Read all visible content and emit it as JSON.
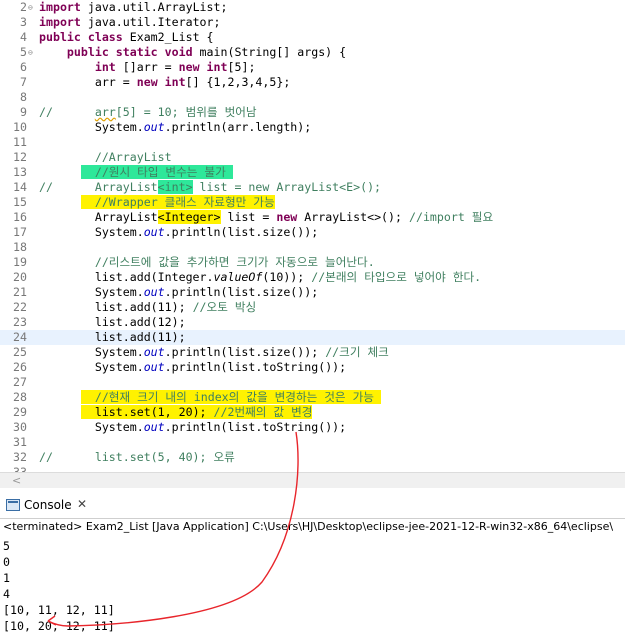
{
  "editor": {
    "lines": [
      {
        "n": "2",
        "fold": "⊖",
        "segs": [
          {
            "t": "import",
            "c": "kw"
          },
          {
            "t": " java.util.ArrayList;"
          }
        ]
      },
      {
        "n": "3",
        "segs": [
          {
            "t": "import",
            "c": "kw"
          },
          {
            "t": " java.util.Iterator;"
          }
        ]
      },
      {
        "n": "4",
        "segs": [
          {
            "t": "public class",
            "c": "kw"
          },
          {
            "t": " Exam2_List {"
          }
        ]
      },
      {
        "n": "5",
        "fold": "⊖",
        "segs": [
          {
            "t": "    "
          },
          {
            "t": "public static void",
            "c": "kw"
          },
          {
            "t": " main(String[] args) {"
          }
        ]
      },
      {
        "n": "6",
        "segs": [
          {
            "t": "        "
          },
          {
            "t": "int",
            "c": "kw"
          },
          {
            "t": " []arr = "
          },
          {
            "t": "new int",
            "c": "kw"
          },
          {
            "t": "[5];"
          }
        ]
      },
      {
        "n": "7",
        "segs": [
          {
            "t": "        arr = "
          },
          {
            "t": "new int",
            "c": "kw"
          },
          {
            "t": "[] {1,2,3,4,5};"
          }
        ]
      },
      {
        "n": "8",
        "segs": []
      },
      {
        "n": "9",
        "segs": [
          {
            "t": "//      ",
            "c": "cm"
          },
          {
            "t": "arr",
            "c": "cm sq"
          },
          {
            "t": "[5] = 10; 범위를 벗어남",
            "c": "cm"
          }
        ]
      },
      {
        "n": "10",
        "segs": [
          {
            "t": "        System."
          },
          {
            "t": "out",
            "c": "fld"
          },
          {
            "t": ".println(arr.length);"
          }
        ]
      },
      {
        "n": "11",
        "segs": []
      },
      {
        "n": "12",
        "segs": [
          {
            "t": "        "
          },
          {
            "t": "//ArrayList",
            "c": "cm"
          }
        ]
      },
      {
        "n": "13",
        "segs": [
          {
            "t": "      "
          },
          {
            "t": "  //원시 타입 변수는 불가 ",
            "c": "cm hl-g"
          }
        ]
      },
      {
        "n": "14",
        "segs": [
          {
            "t": "//      ArrayList",
            "c": "cm"
          },
          {
            "t": "<int>",
            "c": "cm hl-g"
          },
          {
            "t": " list = new ArrayList<E>();",
            "c": "cm"
          }
        ]
      },
      {
        "n": "15",
        "segs": [
          {
            "t": "      "
          },
          {
            "t": "  //Wrapper 클래스 자료형만 가능",
            "c": "cm hl-y"
          }
        ]
      },
      {
        "n": "16",
        "segs": [
          {
            "t": "        ArrayList"
          },
          {
            "t": "<Integer>",
            "c": "hl-y"
          },
          {
            "t": " list = "
          },
          {
            "t": "new",
            "c": "kw"
          },
          {
            "t": " ArrayList<>(); "
          },
          {
            "t": "//import 필요",
            "c": "cm"
          }
        ]
      },
      {
        "n": "17",
        "segs": [
          {
            "t": "        System."
          },
          {
            "t": "out",
            "c": "fld"
          },
          {
            "t": ".println(list.size());"
          }
        ]
      },
      {
        "n": "18",
        "segs": []
      },
      {
        "n": "19",
        "segs": [
          {
            "t": "        "
          },
          {
            "t": "//리스트에 값을 추가하면 크기가 자동으로 늘어난다.",
            "c": "cm"
          }
        ]
      },
      {
        "n": "20",
        "segs": [
          {
            "t": "        list.add(Integer."
          },
          {
            "t": "valueOf",
            "c": "it"
          },
          {
            "t": "(10)); "
          },
          {
            "t": "//본래의 타입으로 넣어야 한다.",
            "c": "cm"
          }
        ]
      },
      {
        "n": "21",
        "segs": [
          {
            "t": "        System."
          },
          {
            "t": "out",
            "c": "fld"
          },
          {
            "t": ".println(list.size());"
          }
        ]
      },
      {
        "n": "22",
        "segs": [
          {
            "t": "        list.add(11); "
          },
          {
            "t": "//오토 박싱",
            "c": "cm"
          }
        ]
      },
      {
        "n": "23",
        "segs": [
          {
            "t": "        list.add(12);"
          }
        ]
      },
      {
        "n": "24",
        "cur": true,
        "segs": [
          {
            "t": "        list.add(11);"
          }
        ]
      },
      {
        "n": "25",
        "segs": [
          {
            "t": "        System."
          },
          {
            "t": "out",
            "c": "fld"
          },
          {
            "t": ".println(list.size()); "
          },
          {
            "t": "//크기 체크",
            "c": "cm"
          }
        ]
      },
      {
        "n": "26",
        "segs": [
          {
            "t": "        System."
          },
          {
            "t": "out",
            "c": "fld"
          },
          {
            "t": ".println(list.toString());"
          }
        ]
      },
      {
        "n": "27",
        "segs": []
      },
      {
        "n": "28",
        "segs": [
          {
            "t": "      "
          },
          {
            "t": "  //현재 크기 내의 index의 값을 변경하는 것은 가능 ",
            "c": "cm hl-y"
          }
        ]
      },
      {
        "n": "29",
        "segs": [
          {
            "t": "      "
          },
          {
            "t": "  list.set(1, 20); ",
            "c": "hl-y"
          },
          {
            "t": "//2번째의 값 변경",
            "c": "cm hl-y"
          }
        ]
      },
      {
        "n": "30",
        "segs": [
          {
            "t": "        System."
          },
          {
            "t": "out",
            "c": "fld"
          },
          {
            "t": ".println(list.toString());"
          }
        ]
      },
      {
        "n": "31",
        "segs": []
      },
      {
        "n": "32",
        "segs": [
          {
            "t": "//      list.set(5, 40); 오류",
            "c": "cm"
          }
        ]
      },
      {
        "n": "33",
        "segs": []
      }
    ]
  },
  "console": {
    "tab_label": "Console",
    "close_glyph": "✕",
    "terminated": "<terminated> Exam2_List [Java Application] C:\\Users\\HJ\\Desktop\\eclipse-jee-2021-12-R-win32-x86_64\\eclipse\\",
    "output": [
      "5",
      "0",
      "1",
      "4",
      "[10, 11, 12, 11]",
      "[10, 20, 12, 11]"
    ]
  },
  "scroll_arrow": "<",
  "colors": {
    "keyword": "#7f0055",
    "comment": "#3f7f5f",
    "field": "#0000c0",
    "highlight_green": "#2ee89a",
    "highlight_yellow": "#fff200",
    "annotation": "#e8252b"
  }
}
